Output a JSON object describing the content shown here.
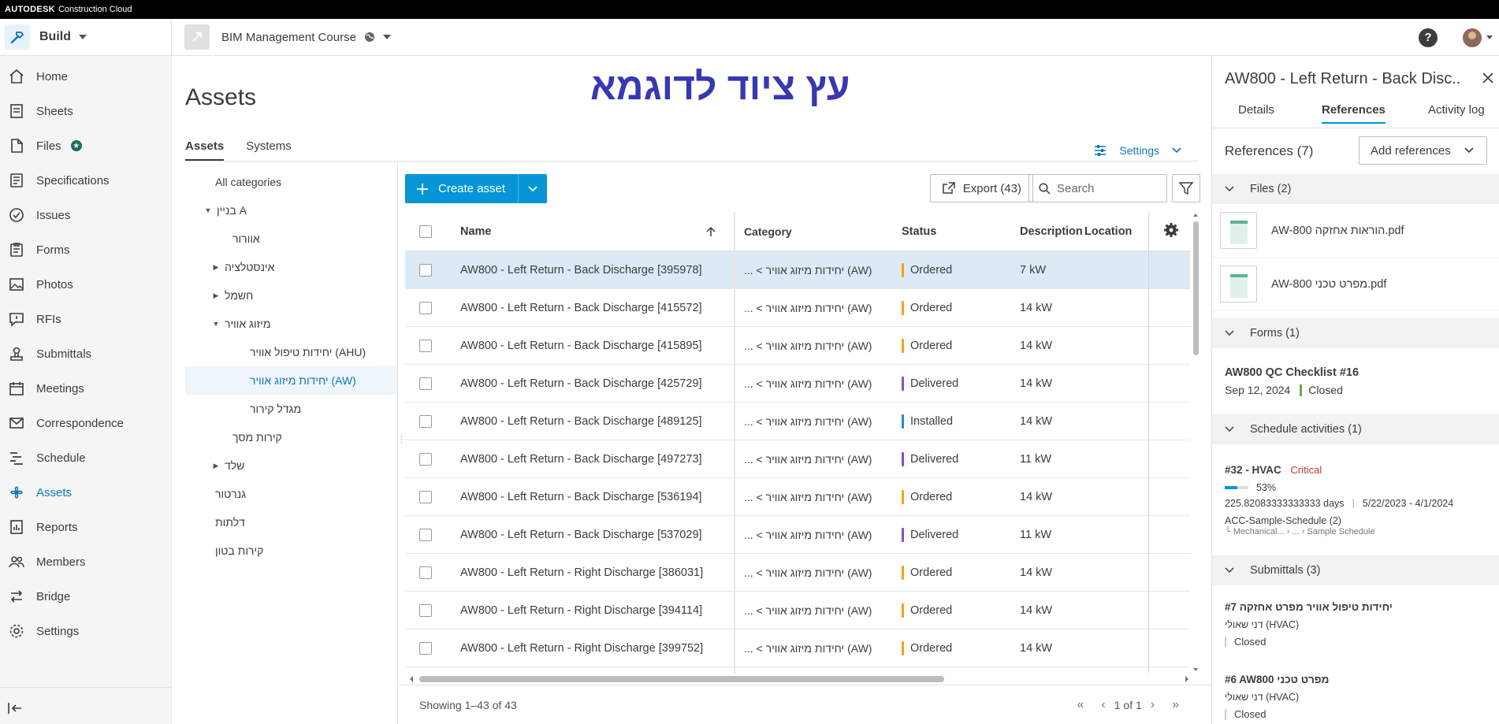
{
  "brand": {
    "name": "AUTODESK",
    "product": "Construction Cloud"
  },
  "header": {
    "product_name": "Build",
    "project_name": "BIM Management Course",
    "help_label": "?"
  },
  "nav": {
    "items": [
      {
        "label": "Home",
        "icon": "home-icon"
      },
      {
        "label": "Sheets",
        "icon": "sheets-icon"
      },
      {
        "label": "Files",
        "icon": "files-icon"
      },
      {
        "label": "Specifications",
        "icon": "specifications-icon"
      },
      {
        "label": "Issues",
        "icon": "issues-icon"
      },
      {
        "label": "Forms",
        "icon": "forms-icon"
      },
      {
        "label": "Photos",
        "icon": "photos-icon"
      },
      {
        "label": "RFIs",
        "icon": "rfis-icon"
      },
      {
        "label": "Submittals",
        "icon": "submittals-icon"
      },
      {
        "label": "Meetings",
        "icon": "meetings-icon"
      },
      {
        "label": "Correspondence",
        "icon": "correspondence-icon"
      },
      {
        "label": "Schedule",
        "icon": "schedule-icon"
      },
      {
        "label": "Assets",
        "icon": "assets-icon"
      },
      {
        "label": "Reports",
        "icon": "reports-icon"
      },
      {
        "label": "Members",
        "icon": "members-icon"
      },
      {
        "label": "Bridge",
        "icon": "bridge-icon"
      },
      {
        "label": "Settings",
        "icon": "settings-icon"
      }
    ],
    "active": "Assets"
  },
  "page": {
    "title": "Assets",
    "overlay_title": "עץ ציוד לדוגמא",
    "tabs": [
      "Assets",
      "Systems"
    ],
    "settings_label": "Settings"
  },
  "tree": {
    "items": [
      {
        "label": "All categories",
        "twisty": ""
      },
      {
        "label": "בניין A",
        "twisty": "▼"
      },
      {
        "label": "אוורור",
        "twisty": ""
      },
      {
        "label": "אינסטלציה",
        "twisty": "▶"
      },
      {
        "label": "חשמל",
        "twisty": "▶"
      },
      {
        "label": "מיזוג אוויר",
        "twisty": "▼"
      },
      {
        "label": "יחידות טיפול אוויר (AHU)",
        "twisty": ""
      },
      {
        "label": "יחידות מיזוג אוויר (AW)",
        "twisty": ""
      },
      {
        "label": "מגדל קירור",
        "twisty": ""
      },
      {
        "label": "קירות מסך",
        "twisty": ""
      },
      {
        "label": "שלד",
        "twisty": "▶"
      },
      {
        "label": "גנרטור",
        "twisty": ""
      },
      {
        "label": "דלתות",
        "twisty": ""
      },
      {
        "label": "קירות בטון",
        "twisty": ""
      }
    ]
  },
  "toolbar": {
    "create_label": "Create asset",
    "export_label": "Export (43)",
    "search_placeholder": "Search"
  },
  "table": {
    "columns": [
      "Name",
      "Category",
      "Status",
      "Description",
      "Location"
    ],
    "rows": [
      {
        "name": "AW800 - Left Return - Back Discharge [395978]",
        "category": "... < יחידות מיזוג אוויר (AW)",
        "status": "Ordered",
        "description": "7 kW"
      },
      {
        "name": "AW800 - Left Return - Back Discharge [415572]",
        "category": "... < יחידות מיזוג אוויר (AW)",
        "status": "Ordered",
        "description": "14 kW"
      },
      {
        "name": "AW800 - Left Return - Back Discharge [415895]",
        "category": "... < יחידות מיזוג אוויר (AW)",
        "status": "Ordered",
        "description": "14 kW"
      },
      {
        "name": "AW800 - Left Return - Back Discharge [425729]",
        "category": "... < יחידות מיזוג אוויר (AW)",
        "status": "Delivered",
        "description": "14 kW"
      },
      {
        "name": "AW800 - Left Return - Back Discharge [489125]",
        "category": "... < יחידות מיזוג אוויר (AW)",
        "status": "Installed",
        "description": "14 kW"
      },
      {
        "name": "AW800 - Left Return - Back Discharge [497273]",
        "category": "... < יחידות מיזוג אוויר (AW)",
        "status": "Delivered",
        "description": "11 kW"
      },
      {
        "name": "AW800 - Left Return - Back Discharge [536194]",
        "category": "... < יחידות מיזוג אוויר (AW)",
        "status": "Ordered",
        "description": "14 kW"
      },
      {
        "name": "AW800 - Left Return - Back Discharge [537029]",
        "category": "... < יחידות מיזוג אוויר (AW)",
        "status": "Delivered",
        "description": "11 kW"
      },
      {
        "name": "AW800 - Left Return - Right Discharge [386031]",
        "category": "... < יחידות מיזוג אוויר (AW)",
        "status": "Ordered",
        "description": "14 kW"
      },
      {
        "name": "AW800 - Left Return - Right Discharge [394114]",
        "category": "... < יחידות מיזוג אוויר (AW)",
        "status": "Ordered",
        "description": "14 kW"
      },
      {
        "name": "AW800 - Left Return - Right Discharge [399752]",
        "category": "... < יחידות מיזוג אוויר (AW)",
        "status": "Ordered",
        "description": "14 kW"
      }
    ],
    "status_colors": {
      "Ordered": "#f0a21b",
      "Delivered": "#8e4cb8",
      "Installed": "#1d8ed1"
    }
  },
  "footer": {
    "showing": "Showing 1–43 of 43",
    "page_label": "1 of 1"
  },
  "panel": {
    "title": "AW800 - Left Return - Back Disc...",
    "tabs": [
      "Details",
      "References",
      "Activity log"
    ],
    "references_title": "References (7)",
    "add_references_label": "Add references",
    "files_section": "Files (2)",
    "files": [
      "AW-800 הוראות אחזקה.pdf",
      "AW-800 מפרט טכני.pdf"
    ],
    "forms_section": "Forms (1)",
    "form": {
      "title": "AW800 QC Checklist  #16",
      "date": "Sep 12, 2024",
      "status": "Closed"
    },
    "schedule_section": "Schedule activities (1)",
    "activity": {
      "title": "#32 - HVAC",
      "flag": "Critical",
      "progress_pct": 53,
      "progress_label": "53%",
      "duration": "225.82083333333333 days",
      "dates": "5/22/2023 - 4/1/2024",
      "schedule": "ACC-Sample-Schedule (2)",
      "path": "└ Mechanical... › ... › Sample Schedule"
    },
    "submittals_section": "Submittals (3)",
    "submittals": [
      {
        "title": "#7  יחידות טיפול אוויר מפרט אחזקה",
        "owner": "דני שאולי (HVAC)",
        "status": "Closed"
      },
      {
        "title": "#6  AW800 מפרט טכני",
        "owner": "דני שאולי (HVAC)",
        "status": "Closed"
      }
    ]
  }
}
